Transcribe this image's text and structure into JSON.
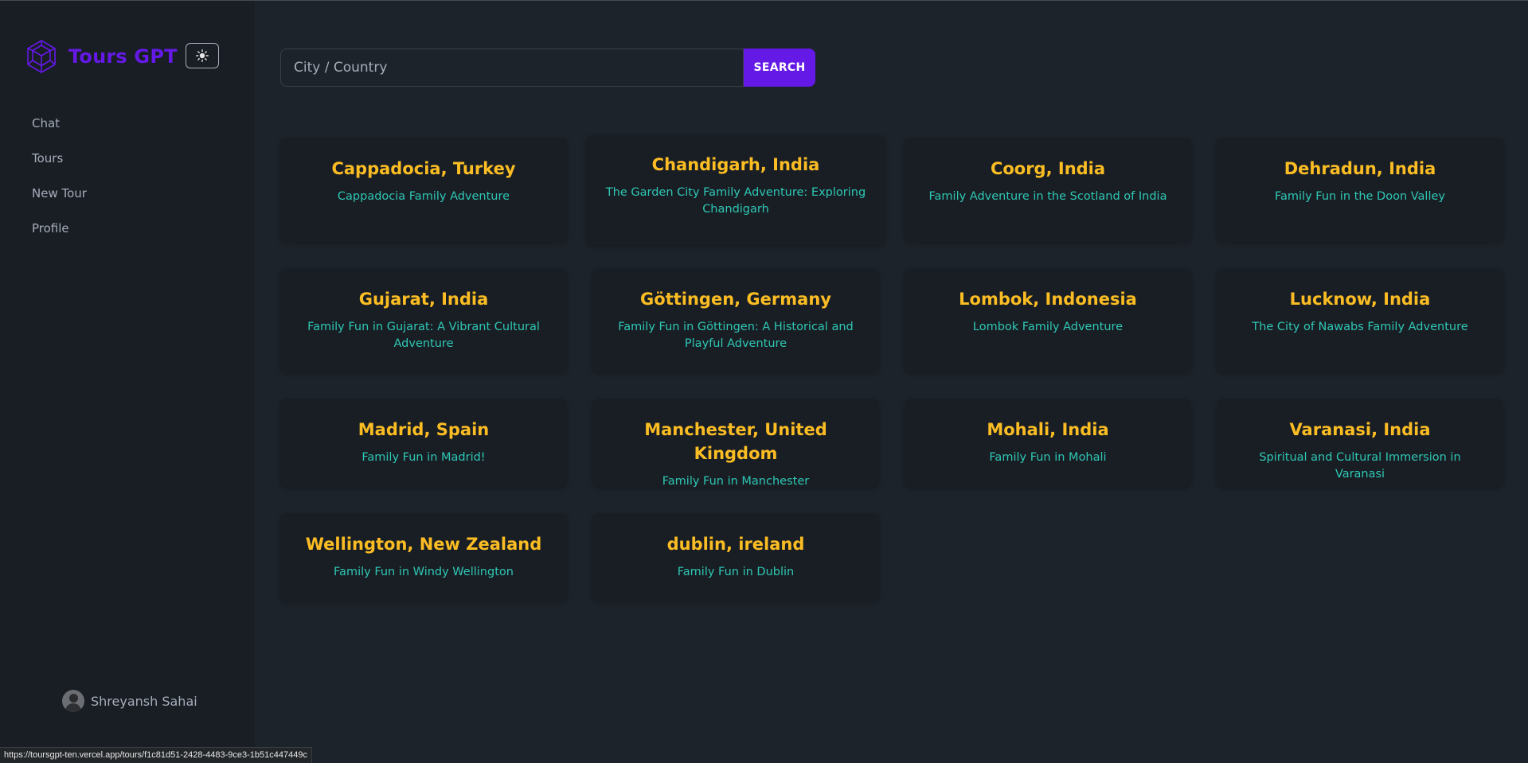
{
  "app": {
    "title": "Tours GPT",
    "theme_icon": "sun-icon",
    "brand_color": "#6419e6",
    "title_color": "#fbbd23",
    "subtitle_color": "#2ec7b4"
  },
  "sidebar": {
    "items": [
      {
        "label": "Chat"
      },
      {
        "label": "Tours"
      },
      {
        "label": "New Tour"
      },
      {
        "label": "Profile"
      }
    ],
    "user": {
      "name": "Shreyansh Sahai"
    }
  },
  "search": {
    "placeholder": "City / Country",
    "value": "",
    "button_label": "SEARCH"
  },
  "tours": [
    {
      "title": "Cappadocia, Turkey",
      "subtitle": "Cappadocia Family Adventure"
    },
    {
      "title": "Chandigarh, India",
      "subtitle": "The Garden City Family Adventure: Exploring Chandigarh"
    },
    {
      "title": "Coorg, India",
      "subtitle": "Family Adventure in the Scotland of India"
    },
    {
      "title": "Dehradun, India",
      "subtitle": "Family Fun in the Doon Valley"
    },
    {
      "title": "Gujarat, India",
      "subtitle": "Family Fun in Gujarat: A Vibrant Cultural Adventure"
    },
    {
      "title": "Göttingen, Germany",
      "subtitle": "Family Fun in Göttingen: A Historical and Playful Adventure"
    },
    {
      "title": "Lombok, Indonesia",
      "subtitle": "Lombok Family Adventure"
    },
    {
      "title": "Lucknow, India",
      "subtitle": "The City of Nawabs Family Adventure"
    },
    {
      "title": "Madrid, Spain",
      "subtitle": "Family Fun in Madrid!"
    },
    {
      "title": "Manchester, United Kingdom",
      "subtitle": "Family Fun in Manchester"
    },
    {
      "title": "Mohali, India",
      "subtitle": "Family Fun in Mohali"
    },
    {
      "title": "Varanasi, India",
      "subtitle": "Spiritual and Cultural Immersion in Varanasi"
    },
    {
      "title": "Wellington, New Zealand",
      "subtitle": "Family Fun in Windy Wellington"
    },
    {
      "title": "dublin, ireland",
      "subtitle": "Family Fun in Dublin"
    }
  ],
  "status_bar": {
    "url": "https://toursgpt-ten.vercel.app/tours/f1c81d51-2428-4483-9ce3-1b51c447449c"
  }
}
